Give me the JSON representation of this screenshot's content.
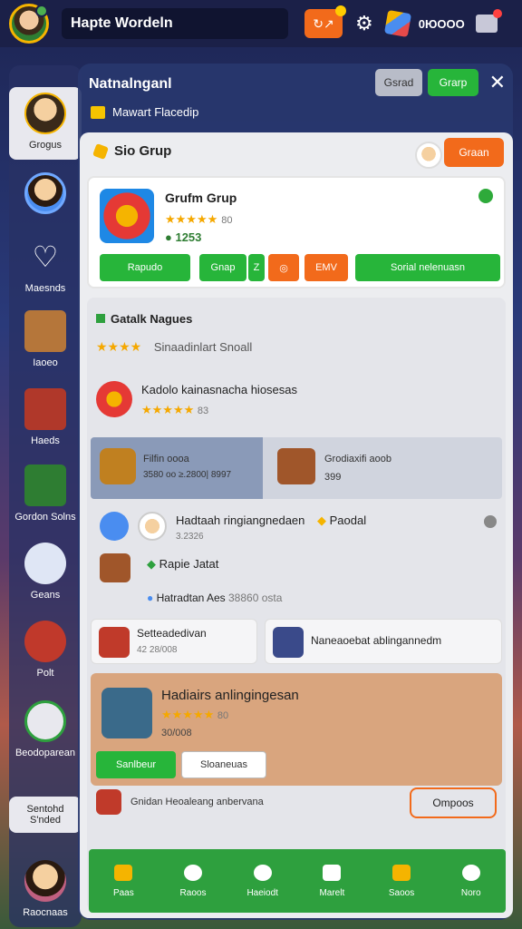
{
  "topbar": {
    "title": "Hapte Wordeln",
    "orange_btn": "↻↗",
    "coins": "0ЮOOO"
  },
  "sidebar": {
    "items": [
      {
        "label": "Grogus"
      },
      {
        "label": ""
      },
      {
        "label": "Maesnds"
      },
      {
        "label": "Iaoeo"
      },
      {
        "label": "Haeds"
      },
      {
        "label": "Gordon Solns"
      },
      {
        "label": "Geans"
      },
      {
        "label": "Polt"
      },
      {
        "label": "Beodoparean"
      },
      {
        "label": "Sentohd S'nded"
      },
      {
        "label": "Raocnaas"
      }
    ]
  },
  "panel": {
    "title": "Natnalnganl",
    "subtitle": "Mawart Flacedip",
    "btn1": "Gsrad",
    "btn2": "Grarp"
  },
  "group": {
    "header": "Sio Grup",
    "action": "Graan",
    "card": {
      "title": "Grufm Grup",
      "stars": "★★★★★",
      "rating": "80",
      "score": "1253",
      "buttons": [
        "Rapudo",
        "Gnap",
        "Z",
        "",
        "EMV",
        "Sorial nelenuasn"
      ]
    }
  },
  "section": {
    "title": "Gatalk Nagues",
    "stars_label": "Sinaadinlart Snoall",
    "item1_title": "Kadolo kainasnacha hiosesas",
    "item1_rating": "83",
    "band_left_title": "Filfin oooa",
    "band_left_values": "3580 oo  ≥.2800| 8997",
    "band_right_title": "Grodiaxifi aoob",
    "band_right_value": "399",
    "row_title": "Hadtaah ringiangnedaen",
    "row_sub": "3.2326",
    "row_right": "Paodal",
    "row2_title": "Rapie Jatat",
    "row3_title": "Hatradtan Aes",
    "row3_value": "38860 osta",
    "tile_left_title": "Setteadedivan",
    "tile_left_value": "42 28/008",
    "tile_right_title": "Naneaoebat ablingannedm",
    "promo_title": "Hadiairs anlingingesan",
    "promo_rating": "80",
    "promo_value": "30/008",
    "promo_btn1": "Sanlbeur",
    "promo_btn2": "Sloaneuas",
    "footer_text": "Gnidan Heoaleang anbervana",
    "footer_btn": "Ompoos"
  },
  "nav": [
    {
      "label": "Paas"
    },
    {
      "label": "Raoos"
    },
    {
      "label": "Haeiodt"
    },
    {
      "label": "Marelt"
    },
    {
      "label": "Saoos"
    },
    {
      "label": "Noro"
    }
  ]
}
